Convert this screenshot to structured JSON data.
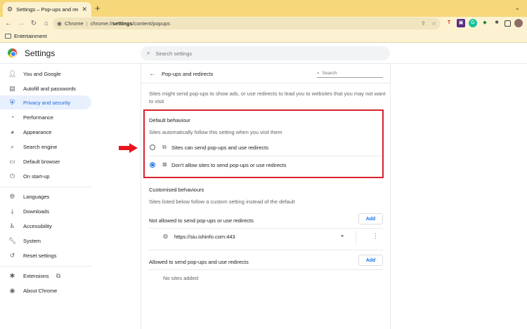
{
  "browser": {
    "tab": {
      "title": "Settings – Pop-ups and redire"
    },
    "omnibox": {
      "chip": "Chrome",
      "url_prefix": "chrome://",
      "url_host": "settings",
      "url_path": "/content/popups"
    },
    "bookmarks": [
      {
        "label": "Entertainment"
      }
    ]
  },
  "header": {
    "title": "Settings",
    "search_placeholder": "Search settings"
  },
  "sidebar": {
    "items": [
      {
        "label": "You and Google",
        "icon": "person-icon"
      },
      {
        "label": "Autofill and passwords",
        "icon": "autofill-icon"
      },
      {
        "label": "Privacy and security",
        "icon": "shield-icon",
        "active": true
      },
      {
        "label": "Performance",
        "icon": "speedometer-icon"
      },
      {
        "label": "Appearance",
        "icon": "palette-icon"
      },
      {
        "label": "Search engine",
        "icon": "search-icon"
      },
      {
        "label": "Default browser",
        "icon": "browser-icon"
      },
      {
        "label": "On start-up",
        "icon": "power-icon"
      },
      {
        "label": "Languages",
        "icon": "globe-icon"
      },
      {
        "label": "Downloads",
        "icon": "download-icon"
      },
      {
        "label": "Accessibility",
        "icon": "accessibility-icon"
      },
      {
        "label": "System",
        "icon": "wrench-icon"
      },
      {
        "label": "Reset settings",
        "icon": "reset-icon"
      },
      {
        "label": "Extensions",
        "icon": "puzzle-icon"
      },
      {
        "label": "About Chrome",
        "icon": "chrome-icon"
      }
    ]
  },
  "page": {
    "title": "Pop-ups and redirects",
    "search_placeholder": "Search",
    "description": "Sites might send pop-ups to show ads, or use redirects to lead you to websites that you may not want to visit",
    "default_behaviour": {
      "heading": "Default behaviour",
      "subtitle": "Sites automatically follow this setting when you visit them",
      "options": [
        {
          "label": "Sites can send pop-ups and use redirects",
          "icon": "open-in-new-icon",
          "selected": false
        },
        {
          "label": "Don't allow sites to send pop-ups or use redirects",
          "icon": "popup-blocked-icon",
          "selected": true
        }
      ]
    },
    "customised": {
      "heading": "Customised behaviours",
      "subtitle": "Sites listed below follow a custom setting instead of the default",
      "not_allowed": {
        "label": "Not allowed to send pop-ups or use redirects",
        "add_label": "Add",
        "sites": [
          {
            "url": "https://siu.ishinfo.com:443"
          }
        ]
      },
      "allowed": {
        "label": "Allowed to send pop-ups and use redirects",
        "add_label": "Add",
        "empty_text": "No sites added"
      }
    }
  },
  "colors": {
    "accent": "#1a73e8",
    "highlight_border": "#d6232f",
    "tabstrip": "#f6d77a",
    "annotation_arrow": "#e8141c"
  }
}
